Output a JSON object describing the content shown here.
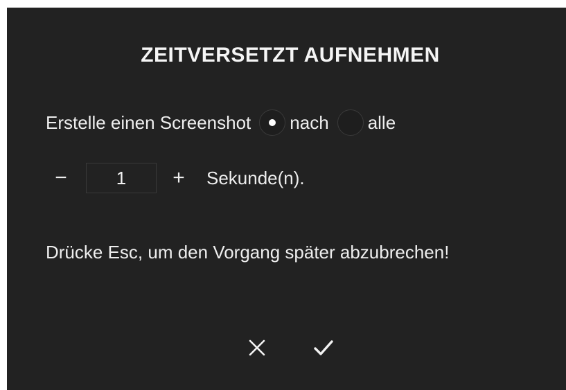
{
  "dialog": {
    "title": "ZEITVERSETZT AUFNEHMEN",
    "capture": {
      "label": "Erstelle einen Screenshot",
      "options": [
        {
          "label": "nach",
          "selected": true
        },
        {
          "label": "alle",
          "selected": false
        }
      ]
    },
    "delay": {
      "decrement_label": "−",
      "value": "1",
      "increment_label": "+",
      "unit_label": "Sekunde(n)."
    },
    "hint": "Drücke Esc, um den Vorgang später abzubrechen!",
    "actions": {
      "cancel_icon": "close-icon",
      "confirm_icon": "check-icon"
    },
    "colors": {
      "background": "#222222",
      "text": "#f2f2f2",
      "border": "#3a3a3a"
    }
  }
}
